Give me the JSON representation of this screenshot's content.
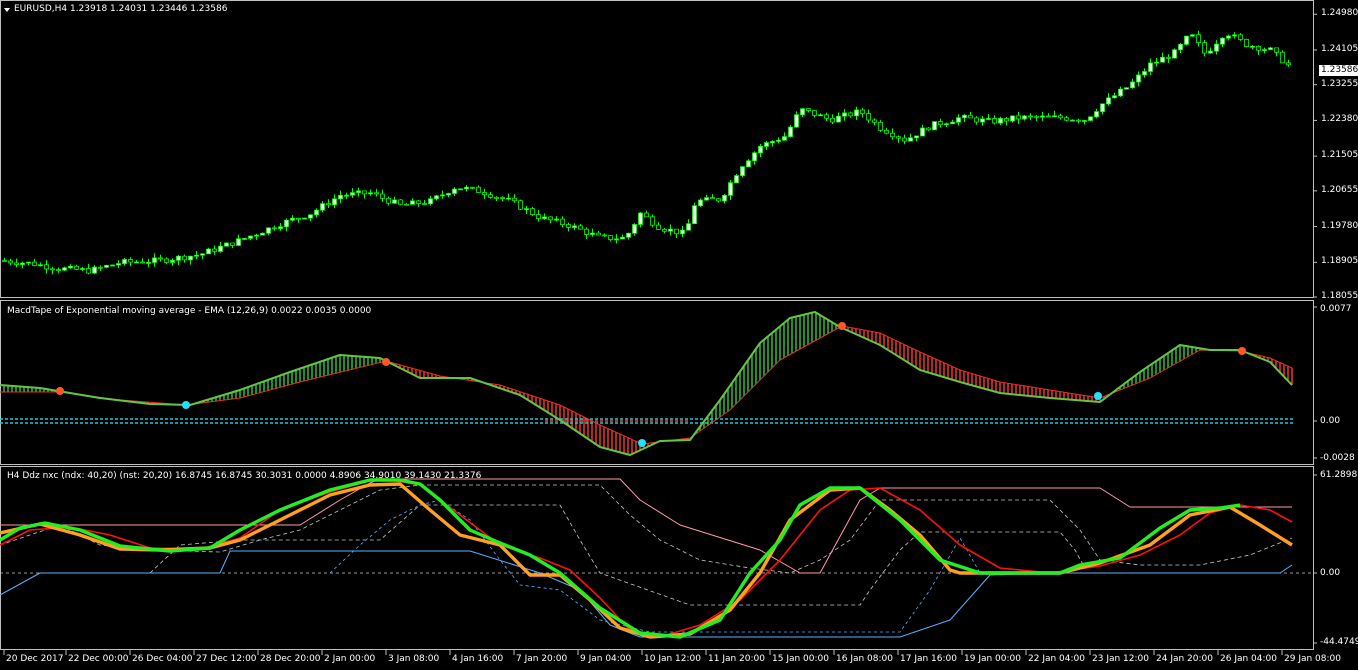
{
  "colors": {
    "background": "#000000",
    "frame": "#c0c0c0",
    "bull_candle": "#ffffff",
    "bear_candle": "#000000",
    "candle_wick": "#00ff00",
    "macd_line": "#62c644",
    "signal_line": "#e8312a",
    "tape_up": "#2ecc40",
    "tape_down": "#ff3b30",
    "marker_bear": "#ff5a1f",
    "marker_bull": "#22e0ff",
    "zero_band": "#22c8d8",
    "ddz_green": "#22ee22",
    "ddz_red": "#ff1010",
    "ddz_orange": "#ffa020",
    "ddz_pink": "#ff9aa8",
    "ddz_blue": "#5ab0ff",
    "ddz_gray": "#c8c8c8"
  },
  "main": {
    "header": "EURUSD,H4  1.23918 1.24031 1.23446 1.23586",
    "current_price": "1.23586",
    "price_labels": [
      "1.24980",
      "1.24105",
      "1.23255",
      "1.22380",
      "1.21505",
      "1.20655",
      "1.19780",
      "1.18905",
      "1.18055"
    ],
    "price_range": [
      1.18055,
      1.2528
    ]
  },
  "macd": {
    "title": "MacdTape of Exponential moving average - EMA (12,26,9) 0.0022 0.0035 0.0000",
    "scale_labels": [
      "0.0077",
      "0.00",
      "-0.0028"
    ]
  },
  "ddz": {
    "title": "H4 Ddz nxc (ndx: 40,20) (nst: 20,20) 16.8745 16.8745 30.3031 0.0000 4.8906 34.9010 39.1430 21.3376",
    "scale_labels": [
      "61.2898",
      "0.00",
      "-44.4749"
    ]
  },
  "time_axis": [
    "20 Dec 2017",
    "22 Dec 00:00",
    "26 Dec 04:00",
    "27 Dec 12:00",
    "28 Dec 20:00",
    "2 Jan 00:00",
    "3 Jan 08:00",
    "4 Jan 16:00",
    "7 Jan 20:00",
    "9 Jan 04:00",
    "10 Jan 12:00",
    "11 Jan 20:00",
    "15 Jan 00:00",
    "16 Jan 08:00",
    "17 Jan 16:00",
    "19 Jan 00:00",
    "22 Jan 04:00",
    "23 Jan 12:00",
    "24 Jan 20:00",
    "26 Jan 04:00",
    "29 Jan 08:00"
  ],
  "price_path": [
    [
      0,
      1.1895
    ],
    [
      30,
      1.1888
    ],
    [
      60,
      1.1875
    ],
    [
      90,
      1.187
    ],
    [
      120,
      1.189
    ],
    [
      160,
      1.1895
    ],
    [
      200,
      1.191
    ],
    [
      240,
      1.1945
    ],
    [
      280,
      1.1985
    ],
    [
      310,
      1.201
    ],
    [
      340,
      1.2055
    ],
    [
      370,
      1.206
    ],
    [
      400,
      1.203
    ],
    [
      430,
      1.204
    ],
    [
      455,
      1.2075
    ],
    [
      480,
      1.2065
    ],
    [
      510,
      1.204
    ],
    [
      540,
      1.2
    ],
    [
      570,
      1.198
    ],
    [
      600,
      1.195
    ],
    [
      625,
      1.195
    ],
    [
      640,
      1.201
    ],
    [
      660,
      1.1975
    ],
    [
      685,
      1.196
    ],
    [
      695,
      1.204
    ],
    [
      720,
      1.2045
    ],
    [
      740,
      1.2125
    ],
    [
      760,
      1.2175
    ],
    [
      785,
      1.22
    ],
    [
      800,
      1.2265
    ],
    [
      830,
      1.224
    ],
    [
      860,
      1.226
    ],
    [
      880,
      1.222
    ],
    [
      905,
      1.219
    ],
    [
      930,
      1.2225
    ],
    [
      960,
      1.2245
    ],
    [
      990,
      1.2235
    ],
    [
      1020,
      1.2245
    ],
    [
      1060,
      1.2245
    ],
    [
      1085,
      1.224
    ],
    [
      1100,
      1.2275
    ],
    [
      1130,
      1.2325
    ],
    [
      1150,
      1.2375
    ],
    [
      1175,
      1.2405
    ],
    [
      1190,
      1.245
    ],
    [
      1205,
      1.24
    ],
    [
      1225,
      1.2455
    ],
    [
      1245,
      1.2425
    ],
    [
      1270,
      1.241
    ],
    [
      1292,
      1.2365
    ]
  ]
}
